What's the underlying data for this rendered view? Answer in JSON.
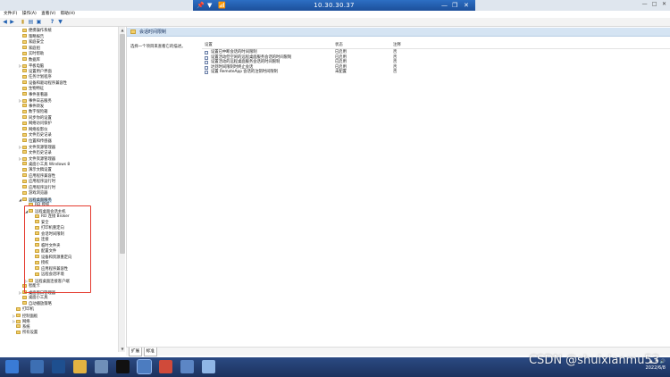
{
  "remote_bar": {
    "address": "10.30.30.37",
    "pin_glyph": "📌",
    "arrow_glyph": "▼",
    "signal_glyph": "📶",
    "minimize_glyph": "—",
    "restore_glyph": "❐",
    "close_glyph": "✕"
  },
  "window_controls": [
    "—",
    "□",
    "✕"
  ],
  "menu": [
    "文件(F)",
    "操作(A)",
    "查看(V)",
    "帮助(H)"
  ],
  "toolbar": {
    "back": "◀",
    "forward": "▶",
    "up": "▮",
    "show_hide": "▤",
    "properties": "▣",
    "help": "?",
    "filter": "▼"
  },
  "tree": [
    {
      "indent": 2,
      "exp": "",
      "label": "便携操作系统"
    },
    {
      "indent": 2,
      "exp": "",
      "label": "策略报告"
    },
    {
      "indent": 2,
      "exp": "",
      "label": "家庭安全"
    },
    {
      "indent": 2,
      "exp": "",
      "label": "家庭组"
    },
    {
      "indent": 2,
      "exp": "",
      "label": "实时帮助"
    },
    {
      "indent": 2,
      "exp": "",
      "label": "数据库"
    },
    {
      "indent": 2,
      "exp": "▷",
      "label": "平板电脑"
    },
    {
      "indent": 2,
      "exp": "",
      "label": "设置用户界面"
    },
    {
      "indent": 2,
      "exp": "",
      "label": "任务计划程序"
    },
    {
      "indent": 2,
      "exp": "",
      "label": "设备和驱动程序兼容性"
    },
    {
      "indent": 2,
      "exp": "",
      "label": "生物特征"
    },
    {
      "indent": 2,
      "exp": "",
      "label": "事件查看器"
    },
    {
      "indent": 2,
      "exp": "▷",
      "label": "事件日志服务"
    },
    {
      "indent": 2,
      "exp": "",
      "label": "事件转发"
    },
    {
      "indent": 2,
      "exp": "",
      "label": "数字保险箱"
    },
    {
      "indent": 2,
      "exp": "",
      "label": "同步你的设置"
    },
    {
      "indent": 2,
      "exp": "",
      "label": "网络访问保护"
    },
    {
      "indent": 2,
      "exp": "",
      "label": "网络投影仪"
    },
    {
      "indent": 2,
      "exp": "",
      "label": "文件历史记录"
    },
    {
      "indent": 2,
      "exp": "",
      "label": "位置和传感器"
    },
    {
      "indent": 2,
      "exp": "▷",
      "label": "文件资源管理器"
    },
    {
      "indent": 2,
      "exp": "",
      "label": "文件历史记录"
    },
    {
      "indent": 2,
      "exp": "▷",
      "label": "文件资源管理器"
    },
    {
      "indent": 2,
      "exp": "",
      "label": "桌面小工具 Windows 8"
    },
    {
      "indent": 2,
      "exp": "",
      "label": "演示文稿设置"
    },
    {
      "indent": 2,
      "exp": "",
      "label": "应用程序兼容性"
    },
    {
      "indent": 2,
      "exp": "",
      "label": "应用程序运行时"
    },
    {
      "indent": 2,
      "exp": "",
      "label": "应用程序运行时"
    },
    {
      "indent": 2,
      "exp": "",
      "label": "游戏浏览器"
    },
    {
      "indent": 2,
      "exp": "◢",
      "label": "远程桌面服务",
      "selected": true
    },
    {
      "indent": 3,
      "exp": "",
      "label": "RD 授权"
    },
    {
      "indent": 3,
      "exp": "◢",
      "label": "远程桌面会话主机"
    },
    {
      "indent": 4,
      "exp": "",
      "label": "RD 连接 Broker"
    },
    {
      "indent": 4,
      "exp": "",
      "label": "安全"
    },
    {
      "indent": 4,
      "exp": "",
      "label": "打印机重定向"
    },
    {
      "indent": 4,
      "exp": "",
      "label": "会话时间限制"
    },
    {
      "indent": 4,
      "exp": "",
      "label": "连接"
    },
    {
      "indent": 4,
      "exp": "",
      "label": "临时文件夹"
    },
    {
      "indent": 4,
      "exp": "",
      "label": "配置文件"
    },
    {
      "indent": 4,
      "exp": "",
      "label": "设备和资源重定向"
    },
    {
      "indent": 4,
      "exp": "",
      "label": "授权"
    },
    {
      "indent": 4,
      "exp": "",
      "label": "应用程序兼容性"
    },
    {
      "indent": 4,
      "exp": "",
      "label": "远程会话环境"
    },
    {
      "indent": 3,
      "exp": "▷",
      "label": "远程桌面连接客户端"
    },
    {
      "indent": 2,
      "exp": "",
      "label": "智能卡"
    },
    {
      "indent": 2,
      "exp": "▷",
      "label": "桌面窗口管理器"
    },
    {
      "indent": 2,
      "exp": "",
      "label": "桌面小工具"
    },
    {
      "indent": 2,
      "exp": "",
      "label": "自动播放策略"
    },
    {
      "indent": 1,
      "exp": "",
      "label": "打印机"
    },
    {
      "indent": 1,
      "exp": "▷",
      "label": "控制面板"
    },
    {
      "indent": 1,
      "exp": "▷",
      "label": "网络"
    },
    {
      "indent": 1,
      "exp": "",
      "label": "系统"
    },
    {
      "indent": 1,
      "exp": "",
      "label": "所有设置"
    }
  ],
  "pane": {
    "header": "会话时间限制",
    "description": "选择一个项目来查看它的描述。",
    "columns": {
      "setting": "设置",
      "state": "状态",
      "comment": "注释"
    },
    "rows": [
      {
        "name": "设置已中断会话的时间限制",
        "state": "已启用",
        "comment": "否"
      },
      {
        "name": "设置活动但空闲的远程桌面服务会话的时间限制",
        "state": "已启用",
        "comment": "否"
      },
      {
        "name": "设置活动的远程桌面服务会话的时间限制",
        "state": "已启用",
        "comment": "否"
      },
      {
        "name": "达到时间限制时终止会话",
        "state": "已启用",
        "comment": "否"
      },
      {
        "name": "设置 RemoteApp 会话的注销时间限制",
        "state": "未配置",
        "comment": "否"
      }
    ]
  },
  "bottom_tabs": [
    "扩展",
    "标准"
  ],
  "taskbar": {
    "items": [
      {
        "name": "start-icon",
        "color": "#3a7bd5"
      },
      {
        "name": "server-manager-icon",
        "color": "#3d6fb3"
      },
      {
        "name": "powershell-icon",
        "color": "#1e4f8f"
      },
      {
        "name": "file-explorer-icon",
        "color": "#e3b341"
      },
      {
        "name": "task-manager-icon",
        "color": "#6f8fb8"
      },
      {
        "name": "cmd-icon",
        "color": "#111111"
      },
      {
        "name": "group-policy-editor-icon",
        "color": "#4c7cc0"
      },
      {
        "name": "chrome-icon",
        "color": "#d04a3a"
      },
      {
        "name": "mmc-icon",
        "color": "#5c86c5"
      },
      {
        "name": "notepad-icon",
        "color": "#8fb6e6"
      }
    ],
    "tray_date": "2022/6/8"
  },
  "watermark": "CSDN @shuixianmu53",
  "colors": {
    "highlight_box": "#e43a2e",
    "selected_row": "#cce4f7",
    "pane_header": "#d5e4f3",
    "taskbar": "#1c325e"
  }
}
